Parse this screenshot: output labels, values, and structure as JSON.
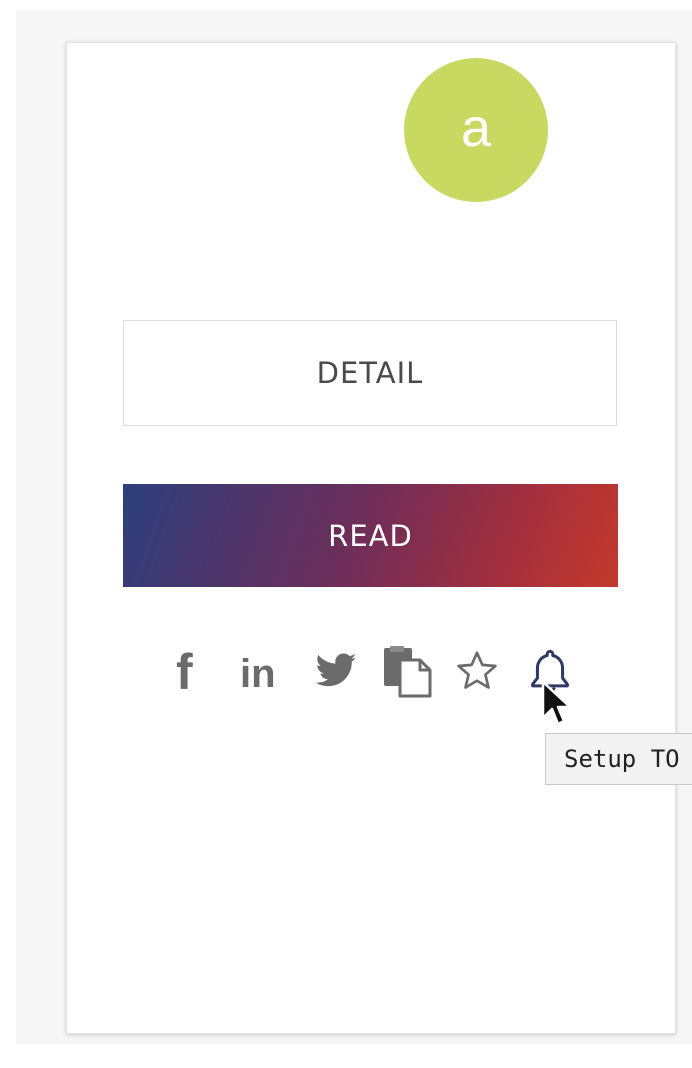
{
  "badge": {
    "letter": "a",
    "color": "#c7d961"
  },
  "buttons": {
    "detail_label": "DETAIL",
    "read_label": "READ"
  },
  "share_icons": [
    {
      "name": "facebook-icon",
      "glyph": "f"
    },
    {
      "name": "linkedin-icon",
      "glyph": "in"
    },
    {
      "name": "twitter-icon"
    },
    {
      "name": "copy-document-icon"
    },
    {
      "name": "star-icon"
    },
    {
      "name": "bell-icon"
    }
  ],
  "tooltip": {
    "text": "Setup TO"
  },
  "colors": {
    "read_gradient": [
      "#2d3f7c",
      "#6a2e5a",
      "#a42f3e",
      "#c33a2c"
    ],
    "icon_gray": "#6b6b6b",
    "bell_outline": "#2e3a66"
  }
}
